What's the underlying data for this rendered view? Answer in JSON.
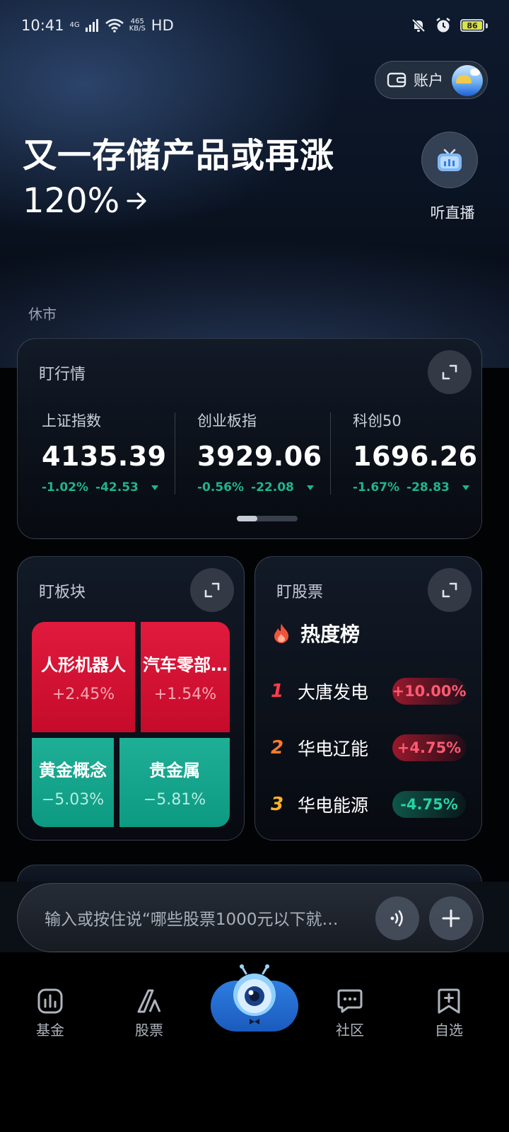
{
  "status_bar": {
    "time": "10:41",
    "network": "4G",
    "speed_value": "465",
    "speed_unit": "KB/S",
    "hd": "HD",
    "battery": "86"
  },
  "account": {
    "label": "账户"
  },
  "headline": {
    "line1": "又一存储产品或再涨",
    "line2": "120%"
  },
  "live": {
    "label": "听直播"
  },
  "market_status": "休市",
  "market_card": {
    "title": "盯行情",
    "indices": [
      {
        "name": "上证指数",
        "value": "4135.39",
        "pct": "-1.02%",
        "change": "-42.53"
      },
      {
        "name": "创业板指",
        "value": "3929.06",
        "pct": "-0.56%",
        "change": "-22.08"
      },
      {
        "name": "科创50",
        "value": "1696.26",
        "pct": "-1.67%",
        "change": "-28.83"
      }
    ],
    "page_index": 1,
    "page_count": 3
  },
  "sector_card": {
    "title": "盯板块",
    "tiles": [
      {
        "name": "人形机器人",
        "pct": "+2.45%"
      },
      {
        "name": "汽车零部…",
        "pct": "+1.54%"
      },
      {
        "name": "黄金概念",
        "pct": "−5.03%"
      },
      {
        "name": "贵金属",
        "pct": "−5.81%"
      }
    ]
  },
  "stock_card": {
    "title": "盯股票",
    "list_title": "热度榜",
    "rows": [
      {
        "rank": "1",
        "name": "大唐发电",
        "change": "+10.00%"
      },
      {
        "rank": "2",
        "name": "华电辽能",
        "change": "+4.75%"
      },
      {
        "rank": "3",
        "name": "华电能源",
        "change": "-4.75%"
      }
    ]
  },
  "input": {
    "placeholder": "输入或按住说“哪些股票1000元以下就…"
  },
  "nav": {
    "items": [
      {
        "label": "基金",
        "icon": "bar-chart-icon"
      },
      {
        "label": "股票",
        "icon": "stock-icon"
      },
      {
        "label": "社区",
        "icon": "chat-icon"
      },
      {
        "label": "自选",
        "icon": "bookmark-add-icon"
      }
    ],
    "center_icon": "robot-mascot-icon"
  },
  "colors": {
    "up": "#e01a3e",
    "down": "#1fb58b",
    "accent": "#2f7de0"
  }
}
